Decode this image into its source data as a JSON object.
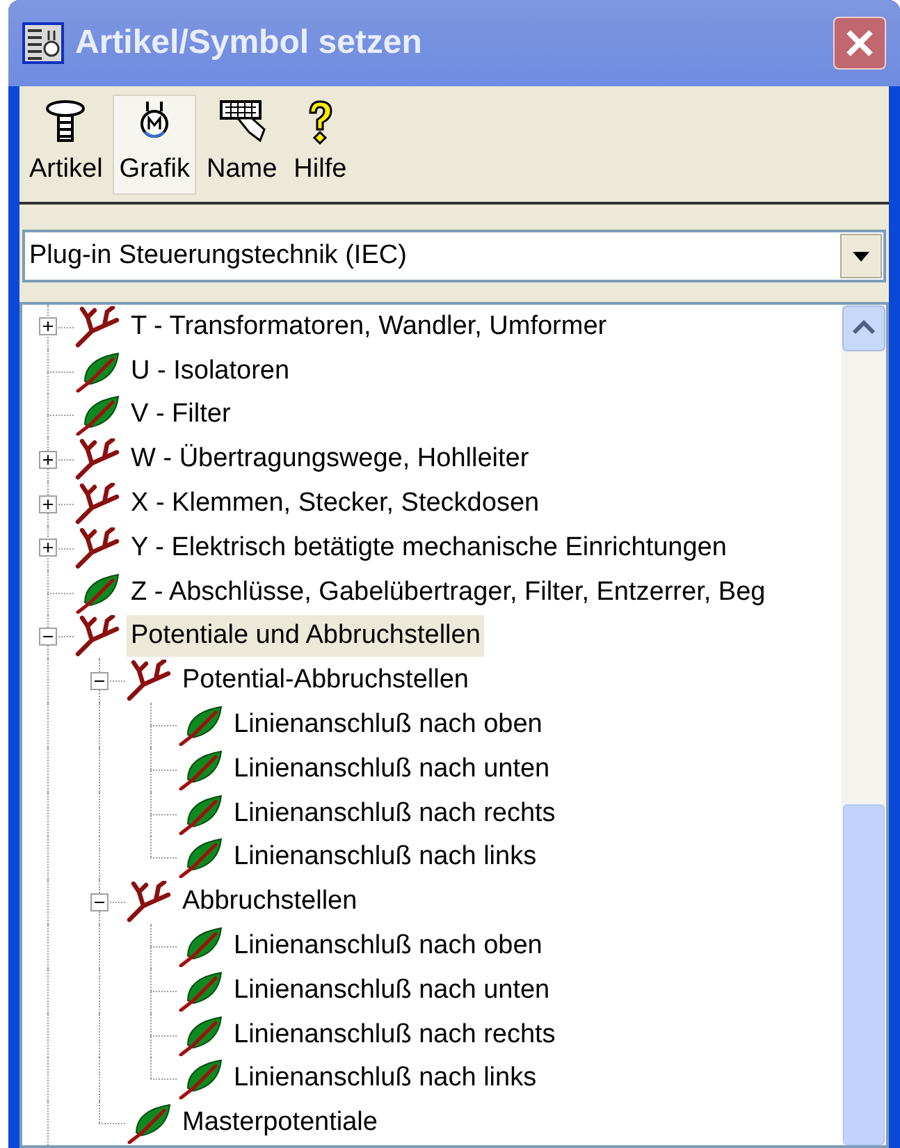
{
  "window": {
    "title": "Artikel/Symbol setzen"
  },
  "toolbar": [
    {
      "label": "Artikel",
      "kind": "screw",
      "selected": false
    },
    {
      "label": "Grafik",
      "kind": "motor",
      "selected": true
    },
    {
      "label": "Name",
      "kind": "keyboard",
      "selected": false
    },
    {
      "label": "Hilfe",
      "kind": "help",
      "selected": false
    }
  ],
  "dropdown": {
    "value": "Plug-in Steuerungstechnik (IEC)"
  },
  "tree": {
    "items": [
      {
        "label": "T - Transformatoren, Wandler, Umformer",
        "kind": "branch",
        "expanded": false,
        "selected": false
      },
      {
        "label": "U - Isolatoren",
        "kind": "leaf",
        "selected": false
      },
      {
        "label": "V - Filter",
        "kind": "leaf",
        "selected": false
      },
      {
        "label": "W - Übertragungswege, Hohlleiter",
        "kind": "branch",
        "expanded": false,
        "selected": false
      },
      {
        "label": "X - Klemmen, Stecker, Steckdosen",
        "kind": "branch",
        "expanded": false,
        "selected": false
      },
      {
        "label": "Y - Elektrisch betätigte mechanische Einrichtungen",
        "kind": "branch",
        "expanded": false,
        "selected": false
      },
      {
        "label": "Z - Abschlüsse, Gabelübertrager, Filter, Entzerrer, Beg",
        "kind": "leaf",
        "selected": false
      },
      {
        "label": "Potentiale und Abbruchstellen",
        "kind": "branch",
        "expanded": true,
        "selected": true,
        "children": [
          {
            "label": "Potential-Abbruchstellen",
            "kind": "branch",
            "expanded": true,
            "selected": false,
            "children": [
              {
                "label": "Linienanschluß nach oben",
                "kind": "leaf",
                "selected": false
              },
              {
                "label": "Linienanschluß nach unten",
                "kind": "leaf",
                "selected": false
              },
              {
                "label": "Linienanschluß nach rechts",
                "kind": "leaf",
                "selected": false
              },
              {
                "label": "Linienanschluß nach links",
                "kind": "leaf",
                "selected": false
              }
            ]
          },
          {
            "label": "Abbruchstellen",
            "kind": "branch",
            "expanded": true,
            "selected": false,
            "children": [
              {
                "label": "Linienanschluß nach oben",
                "kind": "leaf",
                "selected": false
              },
              {
                "label": "Linienanschluß nach unten",
                "kind": "leaf",
                "selected": false
              },
              {
                "label": "Linienanschluß nach rechts",
                "kind": "leaf",
                "selected": false
              },
              {
                "label": "Linienanschluß nach links",
                "kind": "leaf",
                "selected": false
              }
            ]
          },
          {
            "label": "Masterpotentiale",
            "kind": "leaf",
            "selected": false
          }
        ]
      }
    ]
  }
}
